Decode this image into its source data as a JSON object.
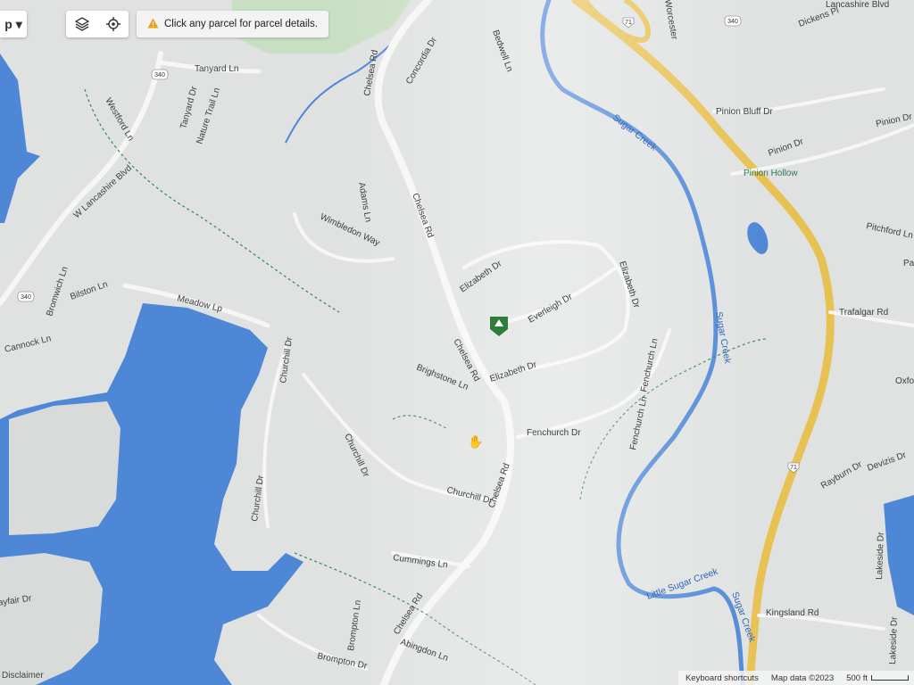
{
  "toolbar": {
    "menu_label": "p ▾",
    "layers_icon": "layers-icon",
    "locate_icon": "locate-icon"
  },
  "hint": {
    "text": "Click any parcel for parcel details.",
    "icon": "warning-icon"
  },
  "footer": {
    "shortcuts": "Keyboard shortcuts",
    "attribution": "Map data ©2023",
    "scale": "500 ft"
  },
  "disclaimer": "Disclaimer",
  "colors": {
    "land": "#dfe2e1",
    "water": "#4e87d6",
    "highway": "#e8c153",
    "road": "#f6f6f4",
    "park": "#c9dfc4",
    "trail": "#2e8b4e"
  },
  "labels": {
    "tanyard": "Tanyard Ln",
    "tanyard_dr": "Tanyard Dr",
    "westford": "Westford Ln",
    "nature_trail": "Nature Trail Ln",
    "lancashire": "W Lancashire Blvd",
    "chelsea": "Chelsea Rd",
    "concordia": "Concordia Dr",
    "bedwell": "Bedwell Ln",
    "adams": "Adams Ln",
    "wimbledon": "Wimbledon Way",
    "bromwich": "Bromwich Ln",
    "bilston": "Bilston Ln",
    "meadow": "Meadow Lp",
    "cannock": "Cannock Ln",
    "elizabeth": "Elizabeth Dr",
    "everleigh": "Everleigh Dr",
    "brighstone": "Brighstone Ln",
    "fenchurch": "Fenchurch Dr",
    "fenchurch_ln": "Fenchurch Ln",
    "churchill": "Churchill Dr",
    "cummings": "Cummings Ln",
    "abingdon": "Abingdon Ln",
    "brompton": "Brompton Dr",
    "brompton_ln": "Brompton Ln",
    "mayfair": "Mayfair Dr",
    "dickens": "Dickens Pl",
    "pinion_bluff": "Pinion Bluff Dr",
    "pinion": "Pinion Dr",
    "pinion_hollow": "Pinion Hollow",
    "pitchford": "Pitchford Ln",
    "par": "Par Ln",
    "trafalgar": "Trafalgar Rd",
    "oxford": "Oxfo",
    "rayburn": "Rayburn Dr",
    "devizis": "Devizis Dr",
    "lakeside": "Lakeside Dr",
    "kingsland": "Kingsland Rd",
    "sugar_creek": "Sugar Creek",
    "little_sugar_creek": "Little Sugar Creek",
    "worcester": "Worcester",
    "lancashire_top": "Lancashire Blvd"
  },
  "shields": {
    "r340": "340",
    "r71": "71"
  }
}
